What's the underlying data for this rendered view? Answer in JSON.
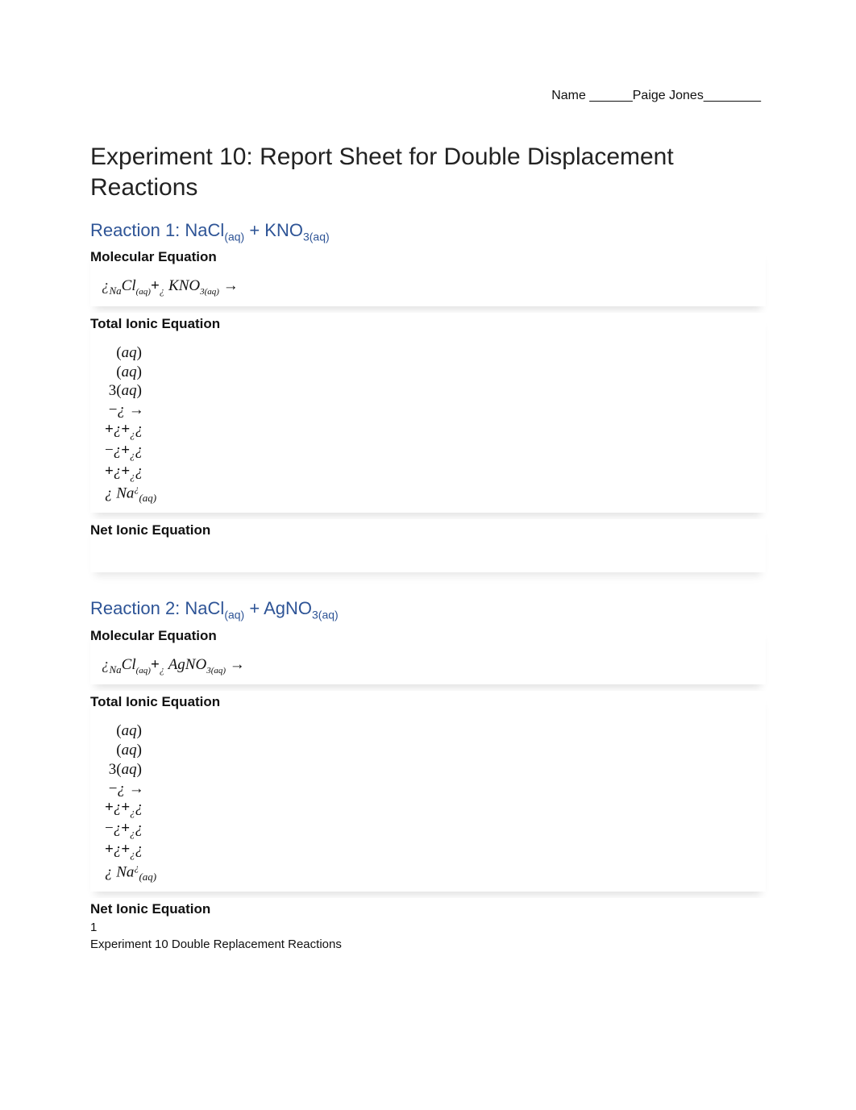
{
  "header": {
    "name_label": "Name",
    "blank_pre": "______",
    "student_name": "Paige Jones",
    "blank_post": "________"
  },
  "title": "Experiment 10: Report Sheet for Double Displacement Reactions",
  "reactions": [
    {
      "heading_prefix": "Reaction 1: NaCl",
      "heading_sub1": "(aq)",
      "heading_mid": " + KNO",
      "heading_sub2": "3(aq)",
      "molecular_label": "Molecular Equation",
      "molecular_eq": {
        "i1": "¿",
        "sub1": "Na",
        "p1": "Cl",
        "sub2": "(aq)",
        "plus": "+",
        "i2": "¿",
        "p2": "KNO",
        "sub3": "3(aq)",
        "arrow": "→"
      },
      "total_ionic_label": "Total Ionic Equation",
      "ionic_rows": [
        "(aq)",
        "(aq)",
        "3(aq)",
        "−¿ →",
        "+¿+¿¿",
        "−¿+¿¿",
        "+¿+¿¿",
        "¿ Na¿(aq)"
      ],
      "net_ionic_label": "Net Ionic Equation"
    },
    {
      "heading_prefix": "Reaction 2: NaCl",
      "heading_sub1": "(aq)",
      "heading_mid": " + AgNO",
      "heading_sub2": "3(aq)",
      "molecular_label": "Molecular Equation",
      "molecular_eq": {
        "i1": "¿",
        "sub1": "Na",
        "p1": "Cl",
        "sub2": "(aq)",
        "plus": "+",
        "i2": "¿",
        "p2": "AgNO",
        "sub3": "3(aq)",
        "arrow": "→"
      },
      "total_ionic_label": "Total Ionic Equation",
      "ionic_rows": [
        "(aq)",
        "(aq)",
        "3(aq)",
        "−¿ →",
        "+¿+¿¿",
        "−¿+¿¿",
        "+¿+¿¿",
        "¿ Na¿(aq)"
      ],
      "net_ionic_label": "Net Ionic Equation"
    }
  ],
  "footer": {
    "page_num": "1",
    "footer_text": "Experiment 10 Double Replacement Reactions"
  }
}
